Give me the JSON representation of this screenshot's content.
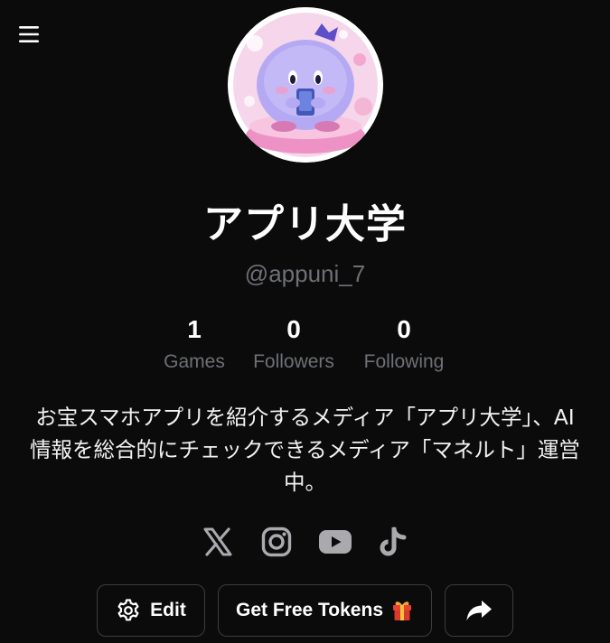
{
  "header": {
    "menu_icon": "hamburger-menu-icon"
  },
  "profile": {
    "avatar_icon": "kirby-mascot-avatar",
    "display_name": "アプリ大学",
    "handle": "@appuni_7",
    "bio": "お宝スマホアプリを紹介するメディア「アプリ大学」、AI情報を総合的にチェックできるメディア「マネルト」運営中。"
  },
  "stats": [
    {
      "value": "1",
      "label": "Games"
    },
    {
      "value": "0",
      "label": "Followers"
    },
    {
      "value": "0",
      "label": "Following"
    }
  ],
  "social": [
    {
      "icon": "x-twitter-icon"
    },
    {
      "icon": "instagram-icon"
    },
    {
      "icon": "youtube-icon"
    },
    {
      "icon": "tiktok-icon"
    }
  ],
  "actions": {
    "edit_label": "Edit",
    "tokens_label": "Get Free Tokens",
    "tokens_emoji": "🎁",
    "share_icon": "share-arrow-icon"
  },
  "colors": {
    "background": "#0b0b0c",
    "muted_text": "#6e7076",
    "button_border": "#3b3d43",
    "avatar_pink": "#f4b8d8",
    "mascot_purple": "#a79cf0"
  }
}
